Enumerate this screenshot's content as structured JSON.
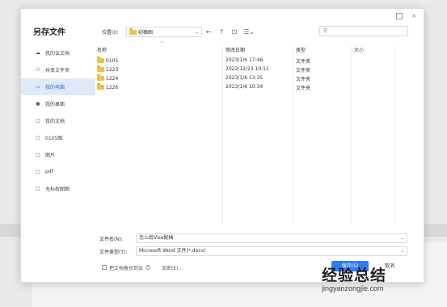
{
  "dialog": {
    "title": "另存文件",
    "window_buttons": {
      "maximize": "",
      "close": "×"
    }
  },
  "sidebar": {
    "items": [
      {
        "label": "我的云文档",
        "icon": "cloud-icon",
        "glyph": "☁"
      },
      {
        "label": "共享文件夹",
        "icon": "shared-icon",
        "glyph": "⚇"
      },
      {
        "label": "我的电脑",
        "icon": "computer-icon",
        "glyph": "▭",
        "selected": true
      },
      {
        "label": "我的桌面",
        "icon": "desktop-icon",
        "glyph": "▣"
      },
      {
        "label": "我的文档",
        "icon": "folder-icon",
        "glyph": "▢"
      },
      {
        "label": "0105图",
        "icon": "folder-icon",
        "glyph": "▢"
      },
      {
        "label": "图片",
        "icon": "folder-icon",
        "glyph": "▢"
      },
      {
        "label": "pdf",
        "icon": "folder-icon",
        "glyph": "▢"
      },
      {
        "label": "无标权图图",
        "icon": "folder-icon",
        "glyph": "▢"
      }
    ]
  },
  "toolbar": {
    "location_label": "位置(I):",
    "location_value": "初稿图",
    "back": "←",
    "up": "↑",
    "new_folder": "⊡",
    "view": "☰⌄",
    "search_glyph": "⚲"
  },
  "columns": {
    "name": "名称",
    "modified": "修改日期",
    "type": "类型",
    "size": "大小"
  },
  "files": [
    {
      "name": "0105",
      "modified": "2023/1/6 17:46",
      "type": "文件夹",
      "size": ""
    },
    {
      "name": "1223",
      "modified": "2022/12/23 10:11",
      "type": "文件夹",
      "size": ""
    },
    {
      "name": "1224",
      "modified": "2023/1/6 13:35",
      "type": "文件夹",
      "size": ""
    },
    {
      "name": "1226",
      "modified": "2023/1/6 10:34",
      "type": "文件夹",
      "size": ""
    }
  ],
  "form": {
    "filename_label": "文件名(N):",
    "filename_value": "怎么给Vise配插",
    "filetype_label": "文件类型(T):",
    "filetype_value": "Microsoft Word 文件(*.docx)",
    "backup_label": "把文档备份到云",
    "encrypt_label": "加密(E)...",
    "save_label": "保存(S)",
    "cancel_label": "取消"
  },
  "watermark": {
    "text": "经验总结",
    "url": "jingyanzongjie.com"
  },
  "colors": {
    "accent": "#2f7cf6",
    "selected_bg": "#dfe9f8",
    "folder": "#f2c14b"
  }
}
